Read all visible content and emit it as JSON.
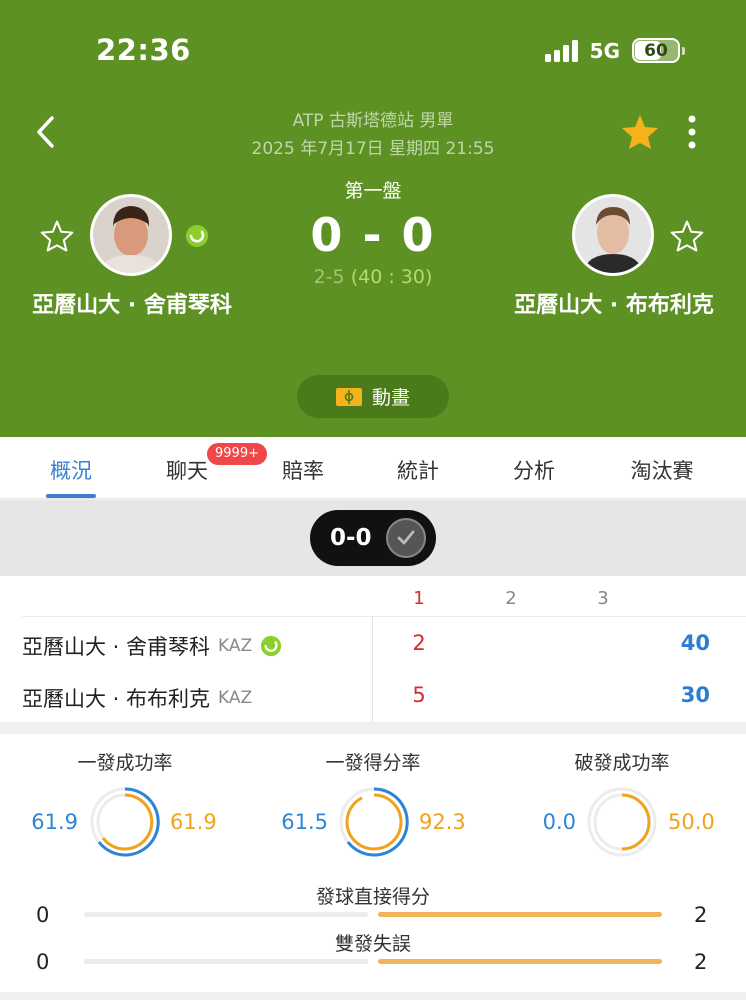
{
  "status_bar": {
    "time": "22:36",
    "network": "5G",
    "battery": "60"
  },
  "match": {
    "event": "ATP 古斯塔德站 男單",
    "datetime": "2025 年7月17日  星期四 21:55",
    "set_label": "第一盤",
    "score": "0 - 0",
    "game_score_prefix": "2-5",
    "game_score_points": "(40 : 30)",
    "animation_label": "動畫"
  },
  "players": {
    "left": {
      "name": "亞曆山大 · 舍甫琴科"
    },
    "right": {
      "name": "亞曆山大 · 布布利克"
    }
  },
  "tabs": [
    {
      "label": "概況",
      "active": true
    },
    {
      "label": "聊天"
    },
    {
      "label": "賠率"
    },
    {
      "label": "統計"
    },
    {
      "label": "分析"
    },
    {
      "label": "淘汰賽"
    }
  ],
  "chat_badge": "9999+",
  "pill": {
    "label": "0-0"
  },
  "score_table": {
    "set_headers": [
      "1",
      "2",
      "3"
    ],
    "rows": [
      {
        "name": "亞曆山大 · 舍甫琴科",
        "country": "KAZ",
        "set1": "2",
        "points": "40",
        "serving": true
      },
      {
        "name": "亞曆山大 · 布布利克",
        "country": "KAZ",
        "set1": "5",
        "points": "30",
        "serving": false
      }
    ]
  },
  "ring_stats": [
    {
      "title": "一發成功率",
      "left": "61.9",
      "right": "61.9"
    },
    {
      "title": "一發得分率",
      "left": "61.5",
      "right": "92.3"
    },
    {
      "title": "破發成功率",
      "left": "0.0",
      "right": "50.0"
    }
  ],
  "bar_stats": [
    {
      "title": "發球直接得分",
      "left": "0",
      "right": "2"
    },
    {
      "title": "雙發失誤",
      "left": "0",
      "right": "2"
    }
  ],
  "colors": {
    "header_green": "#5d9124",
    "accent_blue": "#3a7fd0",
    "accent_orange": "#f0a21d",
    "live_red": "#d62b2b"
  }
}
